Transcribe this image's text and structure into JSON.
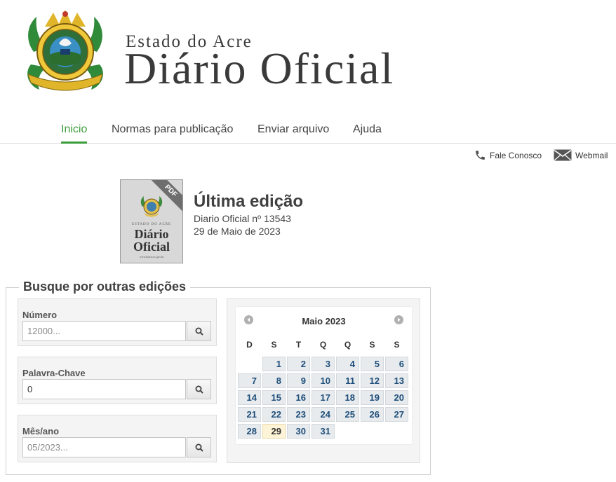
{
  "header": {
    "subtitle": "Estado do Acre",
    "title": "Diário Oficial"
  },
  "nav": {
    "items": [
      {
        "label": "Inicio",
        "active": true
      },
      {
        "label": "Normas para publicação",
        "active": false
      },
      {
        "label": "Enviar arquivo",
        "active": false
      },
      {
        "label": "Ajuda",
        "active": false
      }
    ]
  },
  "links": {
    "contact": {
      "label": "Fale Conosco",
      "icon": "phone-icon"
    },
    "webmail": {
      "label": "Webmail",
      "icon": "envelope-icon"
    }
  },
  "latest": {
    "heading": "Última edição",
    "edition": "Diario Oficial nº 13543",
    "date": "29 de Maio de 2023",
    "thumbnail": {
      "badge": "PDF",
      "small_text": "ESTADO DO ACRE",
      "title_line1": "Diário",
      "title_line2": "Oficial",
      "footer": "www.diario.ac.gov.br"
    }
  },
  "search": {
    "legend": "Busque por outras edições",
    "fields": [
      {
        "label": "Número",
        "value": "",
        "placeholder": "12000..."
      },
      {
        "label": "Palavra-Chave",
        "value": "0",
        "placeholder": ""
      },
      {
        "label": "Mês/ano",
        "value": "",
        "placeholder": "05/2023..."
      }
    ]
  },
  "calendar": {
    "title": "Maio 2023",
    "weekdays": [
      "D",
      "S",
      "T",
      "Q",
      "Q",
      "S",
      "S"
    ],
    "first_weekday_index": 1,
    "days_in_month": 31,
    "highlighted_day": 29
  },
  "colors": {
    "accent_green": "#3c9d3c",
    "day_text": "#1f4e7a",
    "today_bg": "#fdf3d6"
  }
}
